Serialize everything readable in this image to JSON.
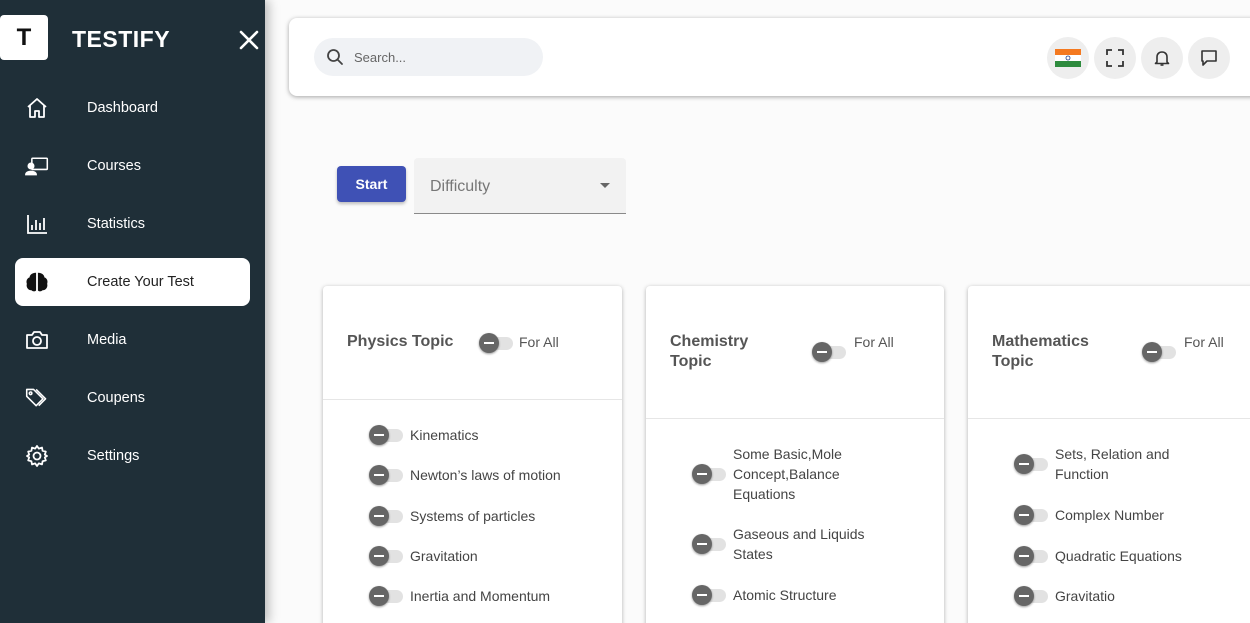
{
  "brand": {
    "logo_letter": "T",
    "name": "TESTIFY"
  },
  "sidebar": {
    "items": [
      {
        "label": "Dashboard",
        "icon": "home-icon"
      },
      {
        "label": "Courses",
        "icon": "courses-icon"
      },
      {
        "label": "Statistics",
        "icon": "bar-chart-icon"
      },
      {
        "label": "Create Your Test",
        "icon": "brain-icon",
        "active": true
      },
      {
        "label": "Media",
        "icon": "camera-icon"
      },
      {
        "label": "Coupens",
        "icon": "tags-icon"
      },
      {
        "label": "Settings",
        "icon": "gear-icon"
      }
    ]
  },
  "header": {
    "search_placeholder": "Search..."
  },
  "controls": {
    "start_label": "Start",
    "difficulty_label": "Difficulty"
  },
  "cards": [
    {
      "title": "Physics Topic",
      "all_label": "For All",
      "topics": [
        "Kinematics",
        "Newton’s laws of motion",
        "Systems of particles",
        "Gravitation",
        "Inertia and Momentum"
      ]
    },
    {
      "title": "Chemistry Topic",
      "all_label": "For All",
      "topics": [
        "Some Basic,Mole Concept,Balance Equations",
        "Gaseous and Liquids States",
        "Atomic Structure"
      ]
    },
    {
      "title": "Mathematics Topic",
      "all_label": "For All",
      "topics": [
        "Sets, Relation and Function",
        "Complex Number",
        "Quadratic Equations",
        "Gravitatio"
      ]
    }
  ],
  "colors": {
    "sidebar_bg": "#1f2f38",
    "primary": "#3f51b5"
  }
}
